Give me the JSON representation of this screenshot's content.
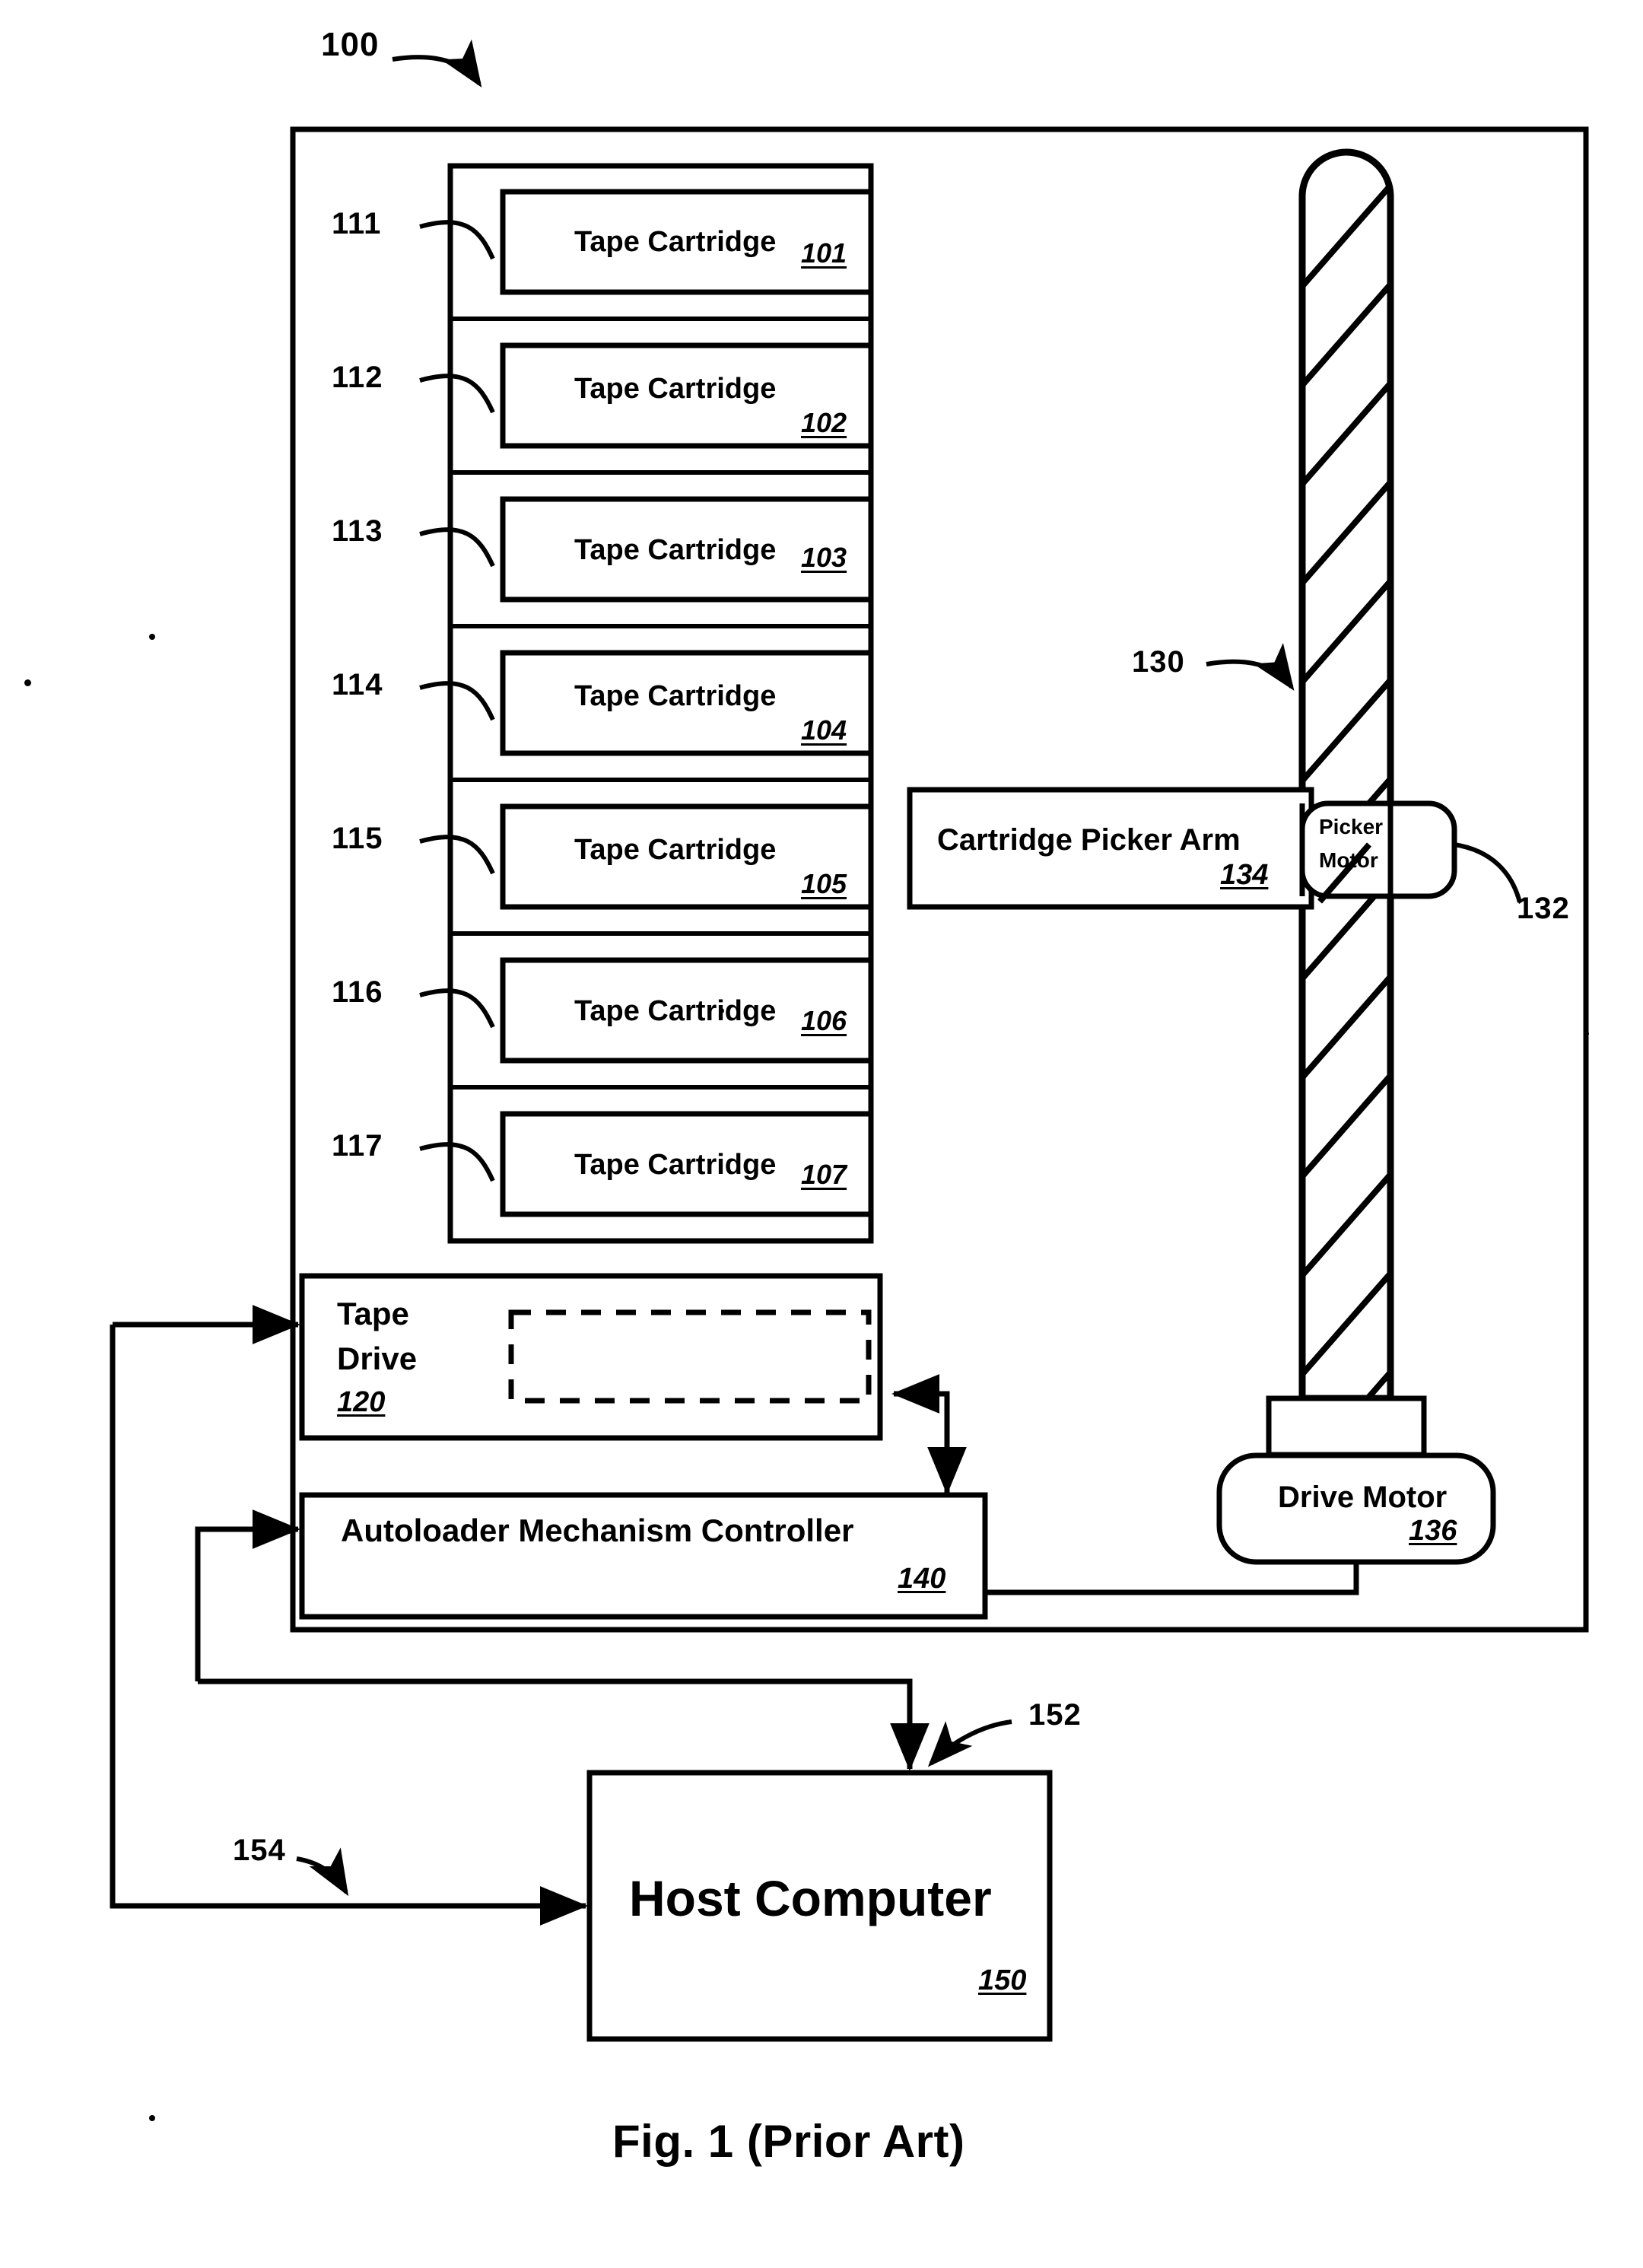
{
  "figure": {
    "caption": "Fig. 1 (Prior Art)",
    "system_ref": "100",
    "autoloader_ref": "130",
    "picker_motor_ref": "132",
    "host_interface_ref": "152",
    "drive_interface_ref": "154"
  },
  "magazine": {
    "slot_refs": [
      "111",
      "112",
      "113",
      "114",
      "115",
      "116",
      "117"
    ],
    "cartridges": [
      {
        "label": "Tape Cartridge",
        "num": "101",
        "num_inline": true
      },
      {
        "label": "Tape Cartridge",
        "num": "102",
        "num_inline": false
      },
      {
        "label": "Tape Cartridge",
        "num": "103",
        "num_inline": true
      },
      {
        "label": "Tape Cartridge",
        "num": "104",
        "num_inline": false
      },
      {
        "label": "Tape Cartridge",
        "num": "105",
        "num_inline": false
      },
      {
        "label": "Tape Cartridge",
        "num": "106",
        "num_inline": true
      },
      {
        "label": "Tape Cartridge",
        "num": "107",
        "num_inline": true
      }
    ]
  },
  "blocks": {
    "tape_drive": {
      "line1": "Tape",
      "line2": "Drive",
      "num": "120"
    },
    "controller": {
      "label": "Autoloader Mechanism Controller",
      "num": "140"
    },
    "picker_arm": {
      "label": "Cartridge Picker Arm",
      "num": "134"
    },
    "picker_motor": {
      "line1": "Picker",
      "line2": "Motor"
    },
    "drive_motor": {
      "label": "Drive Motor",
      "num": "136"
    },
    "host": {
      "label": "Host Computer",
      "num": "150"
    }
  },
  "colors": {
    "ink": "#000000",
    "paper": "#ffffff"
  }
}
